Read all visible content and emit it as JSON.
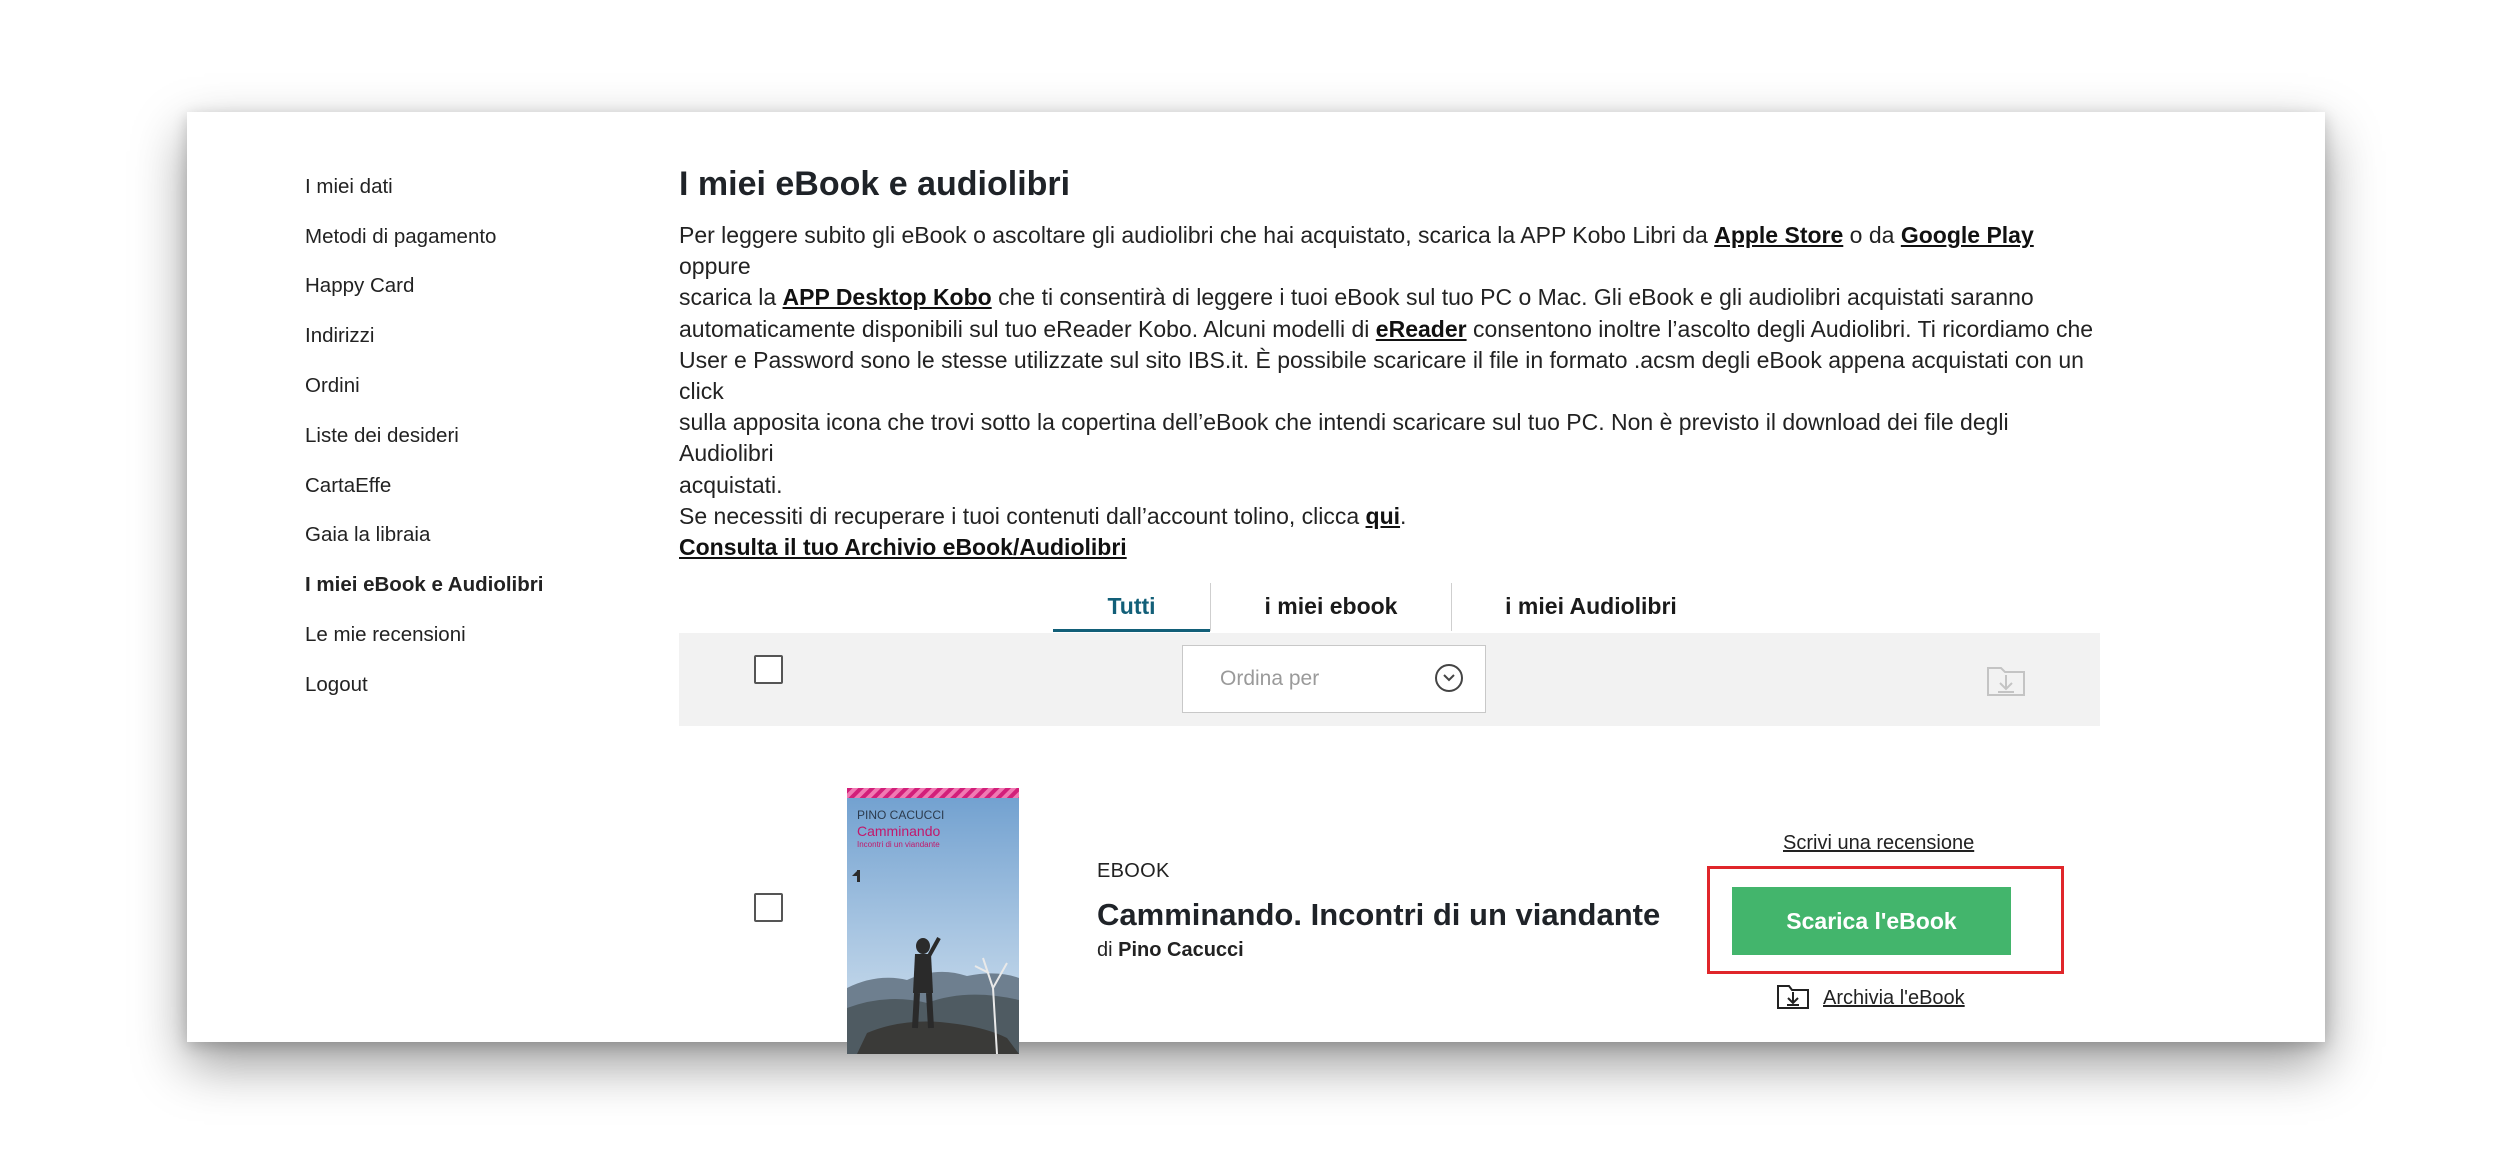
{
  "sidebar": {
    "items": [
      {
        "label": "I miei dati"
      },
      {
        "label": "Metodi di pagamento"
      },
      {
        "label": "Happy Card"
      },
      {
        "label": "Indirizzi"
      },
      {
        "label": "Ordini"
      },
      {
        "label": "Liste dei desideri"
      },
      {
        "label": "CartaEffe"
      },
      {
        "label": "Gaia la libraia"
      },
      {
        "label": "I miei eBook e Audiolibri"
      },
      {
        "label": "Le mie recensioni"
      },
      {
        "label": "Logout"
      }
    ],
    "active_index": 8
  },
  "main": {
    "title": "I miei eBook e audiolibri",
    "intro": {
      "l1_a": "Per leggere subito gli eBook o ascoltare gli audiolibri che hai acquistato, scarica la APP Kobo Libri da ",
      "l1_link1": "Apple Store",
      "l1_b": " o da ",
      "l1_link2": "Google Play",
      "l1_c": " oppure",
      "l2_a": "scarica la ",
      "l2_link": "APP Desktop Kobo",
      "l2_b": " che ti consentirà di leggere i tuoi eBook sul tuo PC o Mac. Gli eBook e gli audiolibri acquistati saranno",
      "l3_a": "automaticamente disponibili sul tuo eReader Kobo. Alcuni modelli di ",
      "l3_link": "eReader",
      "l3_b": " consentono inoltre l’ascolto degli Audiolibri. Ti ricordiamo che",
      "l4": "User e Password sono le stesse utilizzate sul sito IBS.it. È possibile scaricare il file in formato .acsm degli eBook appena acquistati con un click",
      "l5": "sulla apposita icona che trovi sotto la copertina dell’eBook che intendi scaricare sul tuo PC. Non è previsto il download dei file degli Audiolibri",
      "l6": "acquistati.",
      "l7_a": "Se necessiti di recuperare i tuoi contenuti dall’account tolino, clicca ",
      "l7_link": "qui",
      "l7_b": ".",
      "archive_link": "Consulta il tuo Archivio eBook/Audiolibri"
    },
    "tabs": [
      {
        "label": "Tutti"
      },
      {
        "label": "i miei ebook"
      },
      {
        "label": "i miei Audiolibri"
      }
    ],
    "active_tab": 0,
    "sort_placeholder": "Ordina per"
  },
  "book": {
    "type": "EBOOK",
    "title": "Camminando. Incontri di un viandante",
    "author_prefix": "di ",
    "author": "Pino Cacucci",
    "cover_author": "PINO CACUCCI",
    "cover_title": "Camminando",
    "cover_subtitle": "Incontri di un viandante",
    "review_link": "Scrivi una recensione",
    "download_button": "Scarica l'eBook",
    "archive_link": "Archivia l'eBook"
  },
  "colors": {
    "accent_tab": "#125f78",
    "download_button": "#43b56c",
    "highlight_border": "#e0262a"
  }
}
